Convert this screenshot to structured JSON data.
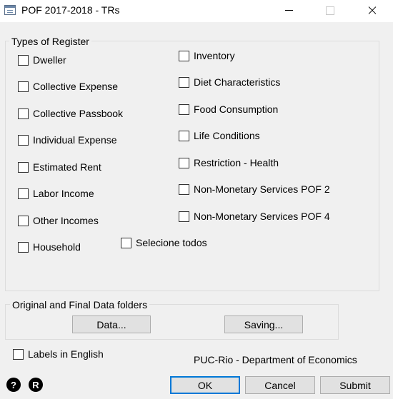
{
  "window": {
    "title": "POF 2017-2018 - TRs",
    "icon": "window-app-icon",
    "controls": [
      "minimize-icon",
      "maximize-icon",
      "close-icon"
    ]
  },
  "register_group": {
    "legend": "Types of Register",
    "left_column": [
      {
        "label": "Dweller",
        "checked": false
      },
      {
        "label": "Collective Expense",
        "checked": false
      },
      {
        "label": "Collective Passbook",
        "checked": false
      },
      {
        "label": "Individual Expense",
        "checked": false
      },
      {
        "label": "Estimated Rent",
        "checked": false
      },
      {
        "label": "Labor Income",
        "checked": false
      },
      {
        "label": "Other Incomes",
        "checked": false
      },
      {
        "label": "Household",
        "checked": false
      }
    ],
    "right_column": [
      {
        "label": "Inventory",
        "checked": false
      },
      {
        "label": "Diet Characteristics",
        "checked": false
      },
      {
        "label": "Food Consumption",
        "checked": false
      },
      {
        "label": "Life Conditions",
        "checked": false
      },
      {
        "label": "Restriction - Health",
        "checked": false
      },
      {
        "label": "Non-Monetary Services POF 2",
        "checked": false
      },
      {
        "label": "Non-Monetary Services POF 4",
        "checked": false
      }
    ],
    "select_all": {
      "label": "Selecione todos",
      "checked": false
    }
  },
  "folders_group": {
    "legend": "Original and Final Data folders",
    "data_button": "Data...",
    "saving_button": "Saving..."
  },
  "labels_english": {
    "label": "Labels in English",
    "checked": false
  },
  "credit": "PUC-Rio - Department of Economics",
  "bottom": {
    "help_icon": "?",
    "r_icon": "R",
    "ok": "OK",
    "cancel": "Cancel",
    "submit": "Submit"
  }
}
